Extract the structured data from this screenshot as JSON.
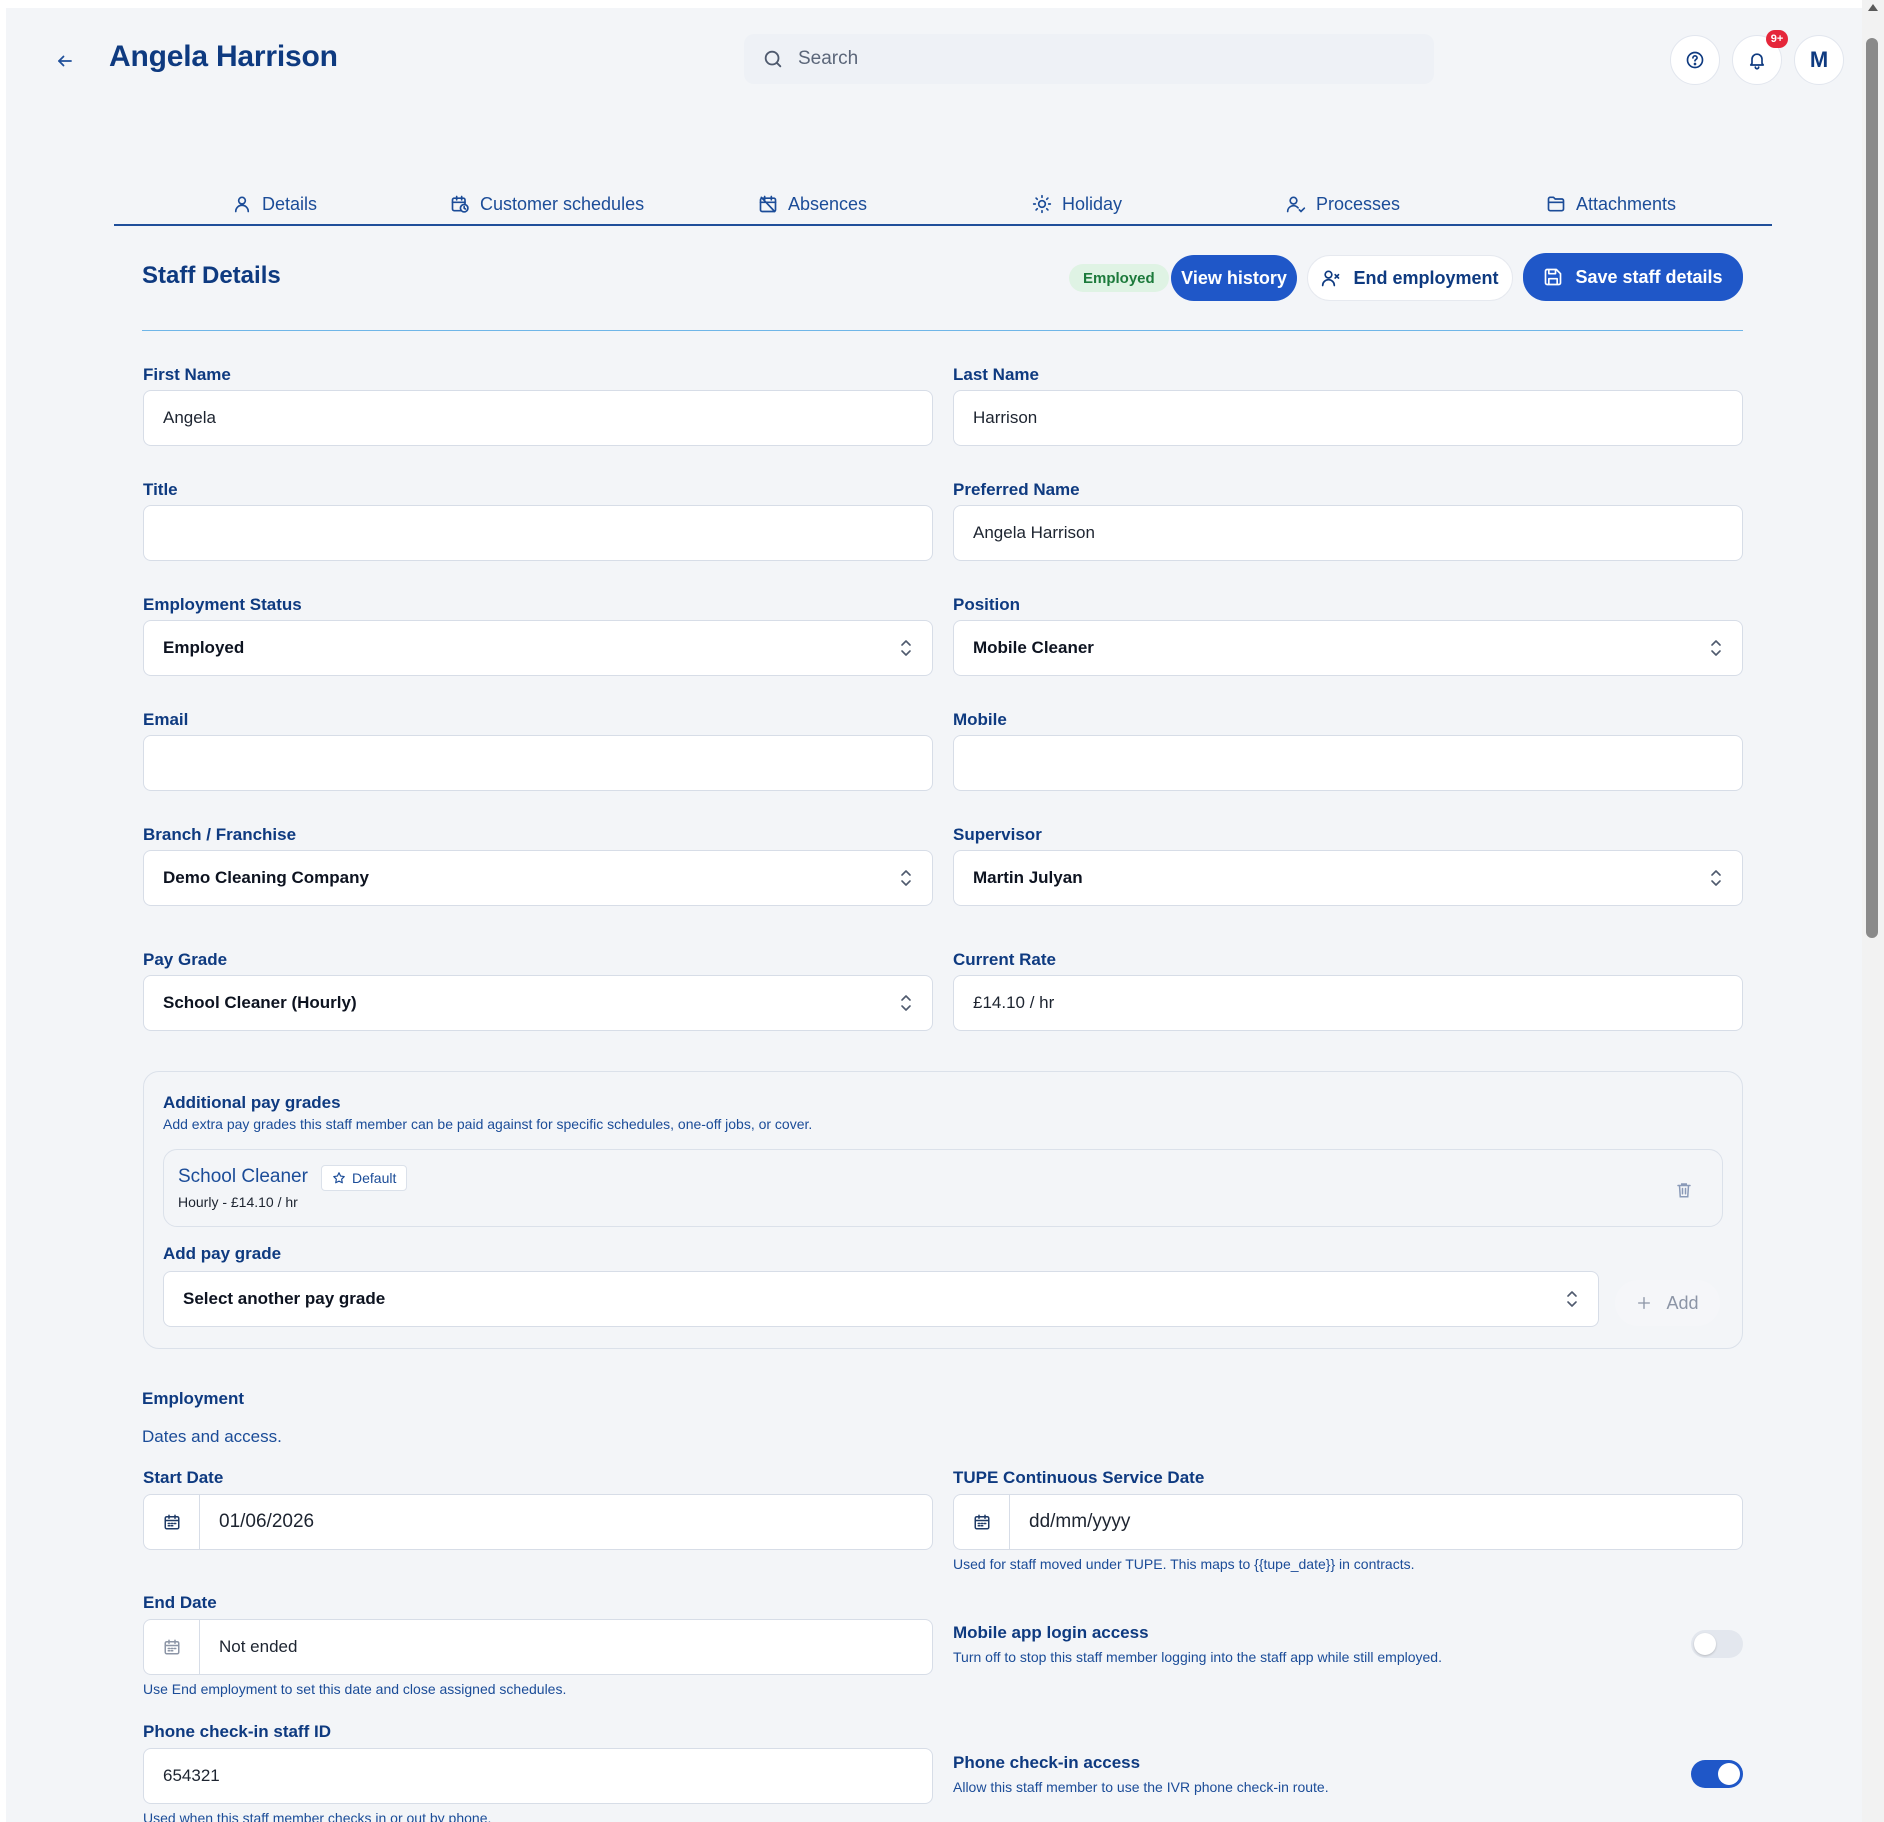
{
  "header": {
    "title": "Angela Harrison",
    "search_placeholder": "Search",
    "notification_badge": "9+",
    "avatar_initial": "M"
  },
  "tabs": [
    {
      "label": "Details",
      "icon": "user-icon"
    },
    {
      "label": "Customer schedules",
      "icon": "calendar-clock-icon"
    },
    {
      "label": "Absences",
      "icon": "calendar-off-icon"
    },
    {
      "label": "Holiday",
      "icon": "sun-icon"
    },
    {
      "label": "Processes",
      "icon": "user-check-icon"
    },
    {
      "label": "Attachments",
      "icon": "folder-icon"
    }
  ],
  "section": {
    "title": "Staff Details",
    "status_chip": "Employed",
    "view_history": "View history",
    "end_employment": "End employment",
    "save": "Save staff details"
  },
  "form": {
    "first_name": {
      "label": "First Name",
      "value": "Angela"
    },
    "last_name": {
      "label": "Last Name",
      "value": "Harrison"
    },
    "title": {
      "label": "Title",
      "value": ""
    },
    "preferred_name": {
      "label": "Preferred Name",
      "value": "Angela Harrison"
    },
    "employment_status": {
      "label": "Employment Status",
      "value": "Employed"
    },
    "position": {
      "label": "Position",
      "value": "Mobile Cleaner"
    },
    "email": {
      "label": "Email",
      "value": ""
    },
    "mobile": {
      "label": "Mobile",
      "value": ""
    },
    "branch": {
      "label": "Branch / Franchise",
      "value": "Demo Cleaning Company"
    },
    "supervisor": {
      "label": "Supervisor",
      "value": "Martin Julyan"
    },
    "pay_grade": {
      "label": "Pay Grade",
      "value": "School Cleaner (Hourly)"
    },
    "current_rate": {
      "label": "Current Rate",
      "value": "£14.10 / hr"
    }
  },
  "additional_pay_grades": {
    "title": "Additional pay grades",
    "subtitle": "Add extra pay grades this staff member can be paid against for specific schedules, one-off jobs, or cover.",
    "items": [
      {
        "name": "School Cleaner",
        "badge": "Default",
        "detail": "Hourly - £14.10 / hr"
      }
    ],
    "add_label": "Add pay grade",
    "add_placeholder": "Select another pay grade",
    "add_button": "Add"
  },
  "employment": {
    "title": "Employment",
    "subtitle": "Dates and access.",
    "start_date": {
      "label": "Start Date",
      "value": "01/06/2026"
    },
    "tupe_date": {
      "label": "TUPE Continuous Service Date",
      "placeholder": "dd/mm/yyyy",
      "help": "Used for staff moved under TUPE. This maps to {{tupe_date}} in contracts."
    },
    "end_date": {
      "label": "End Date",
      "value": "Not ended",
      "help": "Use End employment to set this date and close assigned schedules."
    },
    "mobile_app_access": {
      "title": "Mobile app login access",
      "subtitle": "Turn off to stop this staff member logging into the staff app while still employed.",
      "enabled": false
    },
    "phone_id": {
      "label": "Phone check-in staff ID",
      "value": "654321",
      "help": "Used when this staff member checks in or out by phone."
    },
    "phone_access": {
      "title": "Phone check-in access",
      "subtitle": "Allow this staff member to use the IVR phone check-in route.",
      "enabled": true
    }
  },
  "colors": {
    "primary": "#1f57c8",
    "text_navy": "#0e3a80",
    "background": "#f3f5f8",
    "badge_red": "#e5263a",
    "employed_chip_bg": "#dff3e4"
  }
}
